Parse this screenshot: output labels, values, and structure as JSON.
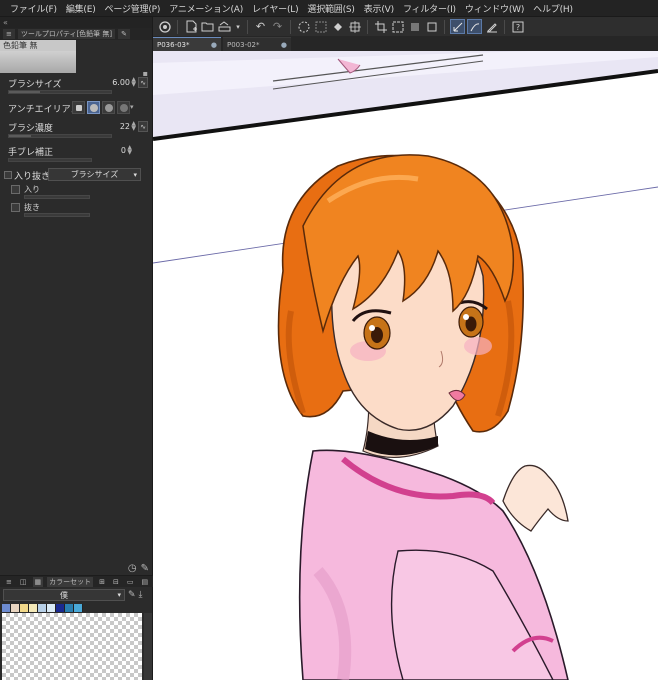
{
  "menu": [
    "ファイル(F)",
    "編集(E)",
    "ページ管理(P)",
    "アニメーション(A)",
    "レイヤー(L)",
    "選択範囲(S)",
    "表示(V)",
    "フィルター(I)",
    "ウィンドウ(W)",
    "ヘルプ(H)"
  ],
  "doc_tabs": [
    {
      "label": "P036-03*",
      "active": true
    },
    {
      "label": "P003-02*",
      "active": false
    }
  ],
  "tool_panel": {
    "tab_label": "ツールプロパティ[色鉛筆 無]",
    "tool_name": "色鉛筆 無",
    "brush_size_label": "ブラシサイズ",
    "brush_size_value": "6.00",
    "antialias_label": "アンチエイリアス",
    "density_label": "ブラシ濃度",
    "density_value": "22",
    "stabilize_label": "手ブレ補正",
    "stabilize_value": "0",
    "taper_label": "入り抜き",
    "taper_select": "ブラシサイズ",
    "start_label": "入り",
    "end_label": "抜き"
  },
  "color_panel": {
    "tab_label": "カラーセット",
    "set_name": "僕",
    "swatches": [
      "#6d8bd0",
      "#e9d5c0",
      "#f2d98a",
      "#f4e9b8",
      "#b7d0e8",
      "#d9eaf6",
      "#1a2a8f",
      "#2a7fb0",
      "#4aa9d8"
    ]
  },
  "icons": {
    "collapse": "«",
    "lock": "🔒",
    "undo": "↶",
    "redo": "↷"
  }
}
